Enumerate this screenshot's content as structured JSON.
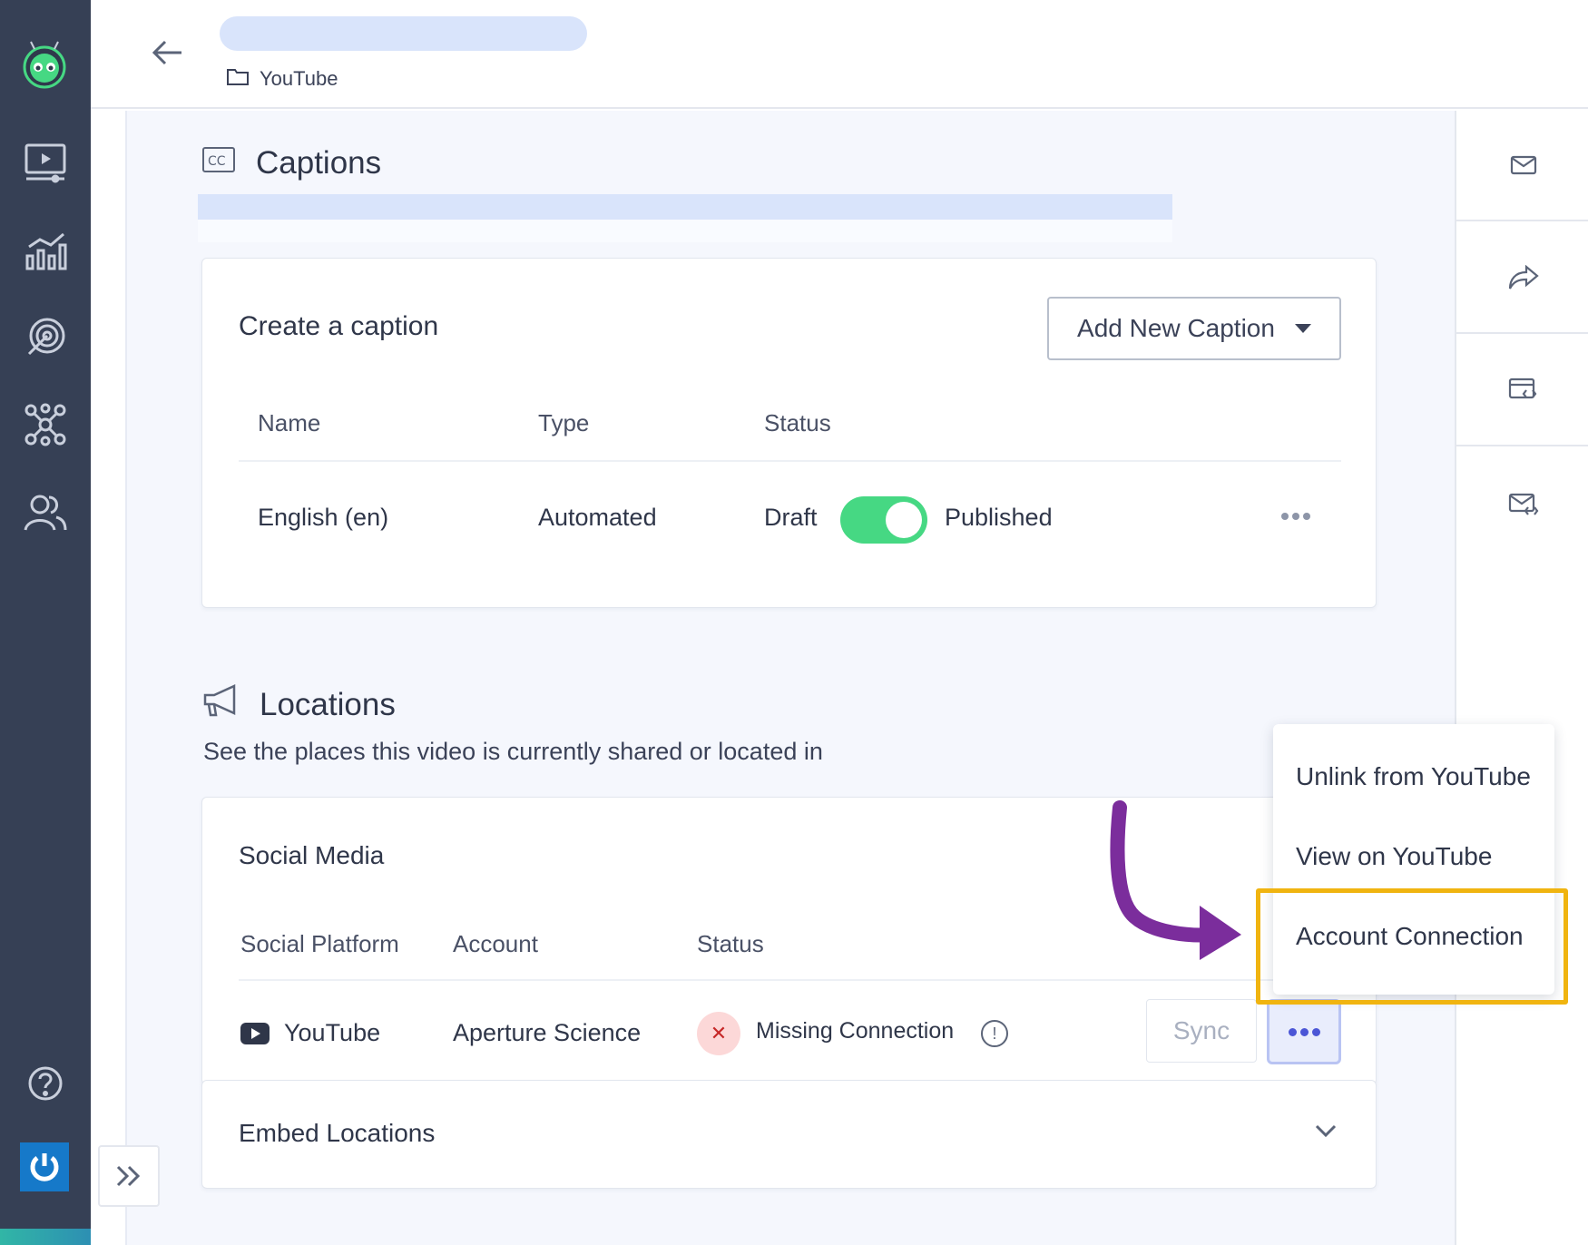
{
  "breadcrumb": {
    "folder_label": "YouTube"
  },
  "captions": {
    "title": "Captions",
    "card_title": "Create a caption",
    "add_button_label": "Add New Caption",
    "columns": [
      "Name",
      "Type",
      "Status"
    ],
    "rows": [
      {
        "name": "English (en)",
        "type": "Automated",
        "status_left": "Draft",
        "status_right": "Published",
        "published": true
      }
    ]
  },
  "locations": {
    "title": "Locations",
    "subtitle": "See the places this video is currently shared or located in",
    "social_card_title": "Social Media",
    "columns": [
      "Social Platform",
      "Account",
      "Status"
    ],
    "rows": [
      {
        "platform": "YouTube",
        "account": "Aperture Science",
        "status": "Missing Connection",
        "sync_label": "Sync"
      }
    ],
    "embed_title": "Embed Locations"
  },
  "menu": {
    "items": [
      "Unlink from YouTube",
      "View on YouTube",
      "Account Connection"
    ],
    "highlighted": "Account Connection"
  },
  "colors": {
    "sidebar": "#364055",
    "toggle_on": "#46d883",
    "highlight": "#f0b410",
    "arrow": "#7b2d9c",
    "accent_dots": "#4b56d6"
  }
}
